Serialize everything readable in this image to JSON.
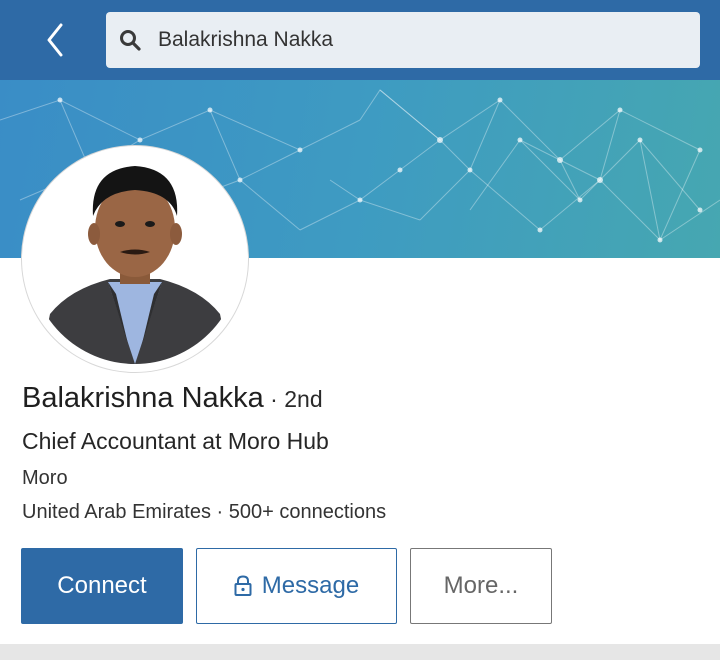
{
  "header": {
    "back_icon": "chevron-left-icon",
    "search": {
      "icon": "search-icon",
      "value": "Balakrishna Nakka"
    }
  },
  "profile": {
    "name": "Balakrishna Nakka",
    "degree": " · 2nd",
    "headline": "Chief Accountant at Moro Hub",
    "company": "Moro",
    "location": "United Arab Emirates",
    "separator": " · ",
    "connections": "500+ connections"
  },
  "actions": {
    "connect_label": "Connect",
    "message_label": "Message",
    "message_icon": "lock-icon",
    "more_label": "More..."
  },
  "colors": {
    "brand_blue": "#2e6aa6",
    "banner_start": "#3a8dc6",
    "banner_end": "#46a7b1"
  }
}
